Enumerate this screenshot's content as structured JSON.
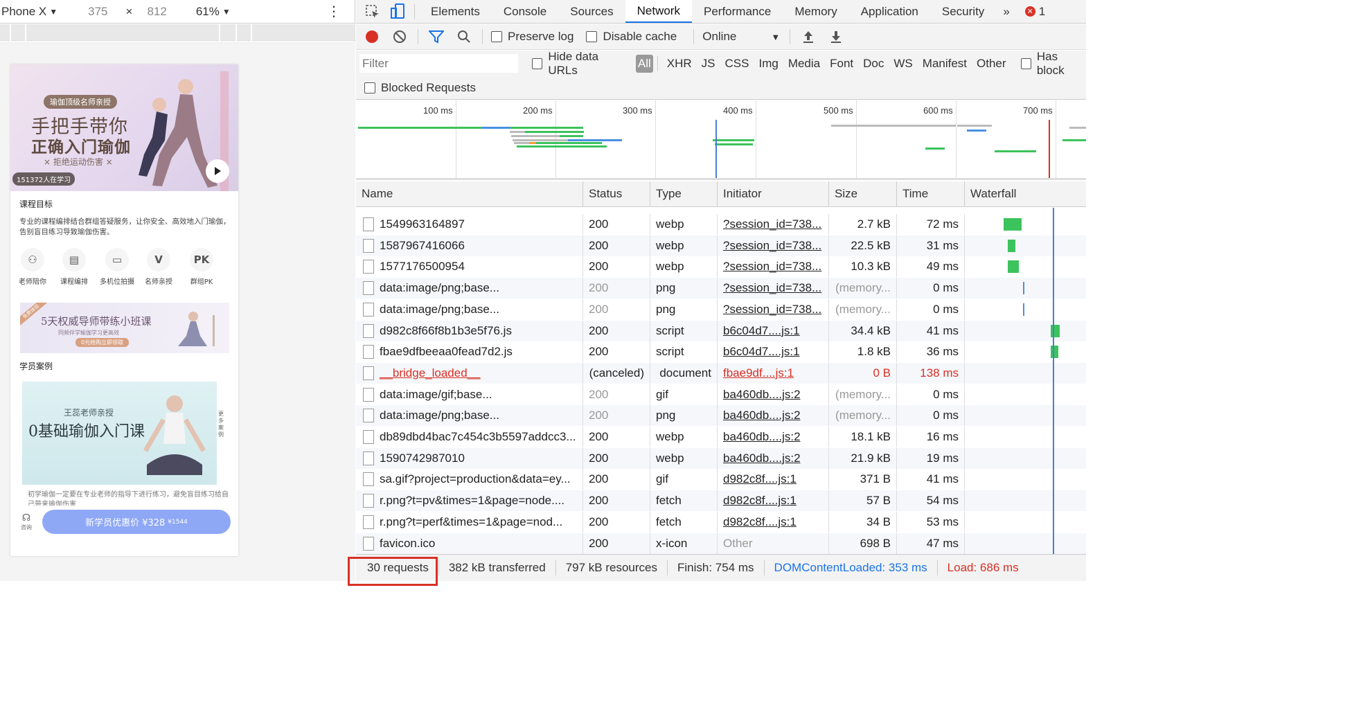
{
  "device_toolbar": {
    "device": "Phone X",
    "width": "375",
    "times": "×",
    "height": "812",
    "zoom": "61%"
  },
  "mobile_page": {
    "hero": {
      "pill": "瑜伽顶级名师亲授",
      "title1": "手把手带你",
      "title2": "正确入门瑜伽",
      "tagline": "× 拒绝运动伤害 ×",
      "learners": "151372人在学习"
    },
    "goal_title": "课程目标",
    "goal_text": "专业的课程编排结合群组答疑服务，让你安全、高效地入门瑜伽，告别盲目练习导致瑜伽伤害。",
    "features": [
      {
        "icon": "people-icon",
        "glyph": "⚇",
        "label": "老师陪你"
      },
      {
        "icon": "book-icon",
        "glyph": "▤",
        "label": "课程编排"
      },
      {
        "icon": "camera-icon",
        "glyph": "▭",
        "label": "多机位拍摄"
      },
      {
        "icon": "v-icon",
        "glyph": "V",
        "label": "名师亲授"
      },
      {
        "icon": "pk-icon",
        "glyph": "PK",
        "label": "群组PK"
      }
    ],
    "banner": {
      "corner": "免费体验",
      "title": "5天权威导师带练小班课",
      "subtitle": "同频伴学瑜伽学习更高效",
      "button": "0元抢购立即领取"
    },
    "cases_title": "学员案例",
    "case": {
      "teacher": "王蕊老师亲授",
      "title": "0基础瑜伽入门课",
      "side": "更多案例"
    },
    "foot_text": "初学瑜伽一定要在专业老师的指导下进行练习，避免盲目练习给自己带来瑜伽伤害",
    "consult": "咨询",
    "cta_label": "新学员优惠价 ¥328",
    "cta_old": "¥1544"
  },
  "devtools": {
    "tabs": [
      "Elements",
      "Console",
      "Sources",
      "Network",
      "Performance",
      "Memory",
      "Application",
      "Security"
    ],
    "active_tab": "Network",
    "more": "»",
    "error_count": "1",
    "toolbar": {
      "preserve_log": "Preserve log",
      "disable_cache": "Disable cache",
      "throttle": "Online"
    },
    "filter_placeholder": "Filter",
    "hide_data_urls": "Hide data URLs",
    "filter_types": [
      "All",
      "XHR",
      "JS",
      "CSS",
      "Img",
      "Media",
      "Font",
      "Doc",
      "WS",
      "Manifest",
      "Other"
    ],
    "has_blocked": "Has block",
    "blocked_requests": "Blocked Requests",
    "overview_ticks": [
      "100 ms",
      "200 ms",
      "300 ms",
      "400 ms",
      "500 ms",
      "600 ms",
      "700 ms"
    ],
    "columns": [
      "Name",
      "Status",
      "Type",
      "Initiator",
      "Size",
      "Time",
      "Waterfall"
    ],
    "rows": [
      {
        "name": "1549963164897",
        "status": "200",
        "type": "webp",
        "initiator": "?session_id=738...",
        "size": "2.7 kB",
        "time": "72 ms"
      },
      {
        "name": "1587967416066",
        "status": "200",
        "type": "webp",
        "initiator": "?session_id=738...",
        "size": "22.5 kB",
        "time": "31 ms"
      },
      {
        "name": "1577176500954",
        "status": "200",
        "type": "webp",
        "initiator": "?session_id=738...",
        "size": "10.3 kB",
        "time": "49 ms"
      },
      {
        "name": "data:image/png;base...",
        "status": "200",
        "type": "png",
        "initiator": "?session_id=738...",
        "size": "(memory...",
        "time": "0 ms"
      },
      {
        "name": "data:image/png;base...",
        "status": "200",
        "type": "png",
        "initiator": "?session_id=738...",
        "size": "(memory...",
        "time": "0 ms"
      },
      {
        "name": "d982c8f66f8b1b3e5f76.js",
        "status": "200",
        "type": "script",
        "initiator": "b6c04d7....js:1",
        "size": "34.4 kB",
        "time": "41 ms"
      },
      {
        "name": "fbae9dfbeeaa0fead7d2.js",
        "status": "200",
        "type": "script",
        "initiator": "b6c04d7....js:1",
        "size": "1.8 kB",
        "time": "36 ms"
      },
      {
        "name": "__bridge_loaded__",
        "status": "(canceled)",
        "type": "document",
        "initiator": "fbae9df....js:1",
        "size": "0 B",
        "time": "138 ms"
      },
      {
        "name": "data:image/gif;base...",
        "status": "200",
        "type": "gif",
        "initiator": "ba460db....js:2",
        "size": "(memory...",
        "time": "0 ms"
      },
      {
        "name": "data:image/png;base...",
        "status": "200",
        "type": "png",
        "initiator": "ba460db....js:2",
        "size": "(memory...",
        "time": "0 ms"
      },
      {
        "name": "db89dbd4bac7c454c3b5597addcc3...",
        "status": "200",
        "type": "webp",
        "initiator": "ba460db....js:2",
        "size": "18.1 kB",
        "time": "16 ms"
      },
      {
        "name": "1590742987010",
        "status": "200",
        "type": "webp",
        "initiator": "ba460db....js:2",
        "size": "21.9 kB",
        "time": "19 ms"
      },
      {
        "name": "sa.gif?project=production&data=ey...",
        "status": "200",
        "type": "gif",
        "initiator": "d982c8f....js:1",
        "size": "371 B",
        "time": "41 ms"
      },
      {
        "name": "r.png?t=pv&times=1&page=node....",
        "status": "200",
        "type": "fetch",
        "initiator": "d982c8f....js:1",
        "size": "57 B",
        "time": "54 ms"
      },
      {
        "name": "r.png?t=perf&times=1&page=nod...",
        "status": "200",
        "type": "fetch",
        "initiator": "d982c8f....js:1",
        "size": "34 B",
        "time": "53 ms"
      },
      {
        "name": "favicon.ico",
        "status": "200",
        "type": "x-icon",
        "initiator": "Other",
        "size": "698 B",
        "time": "47 ms"
      }
    ],
    "status_bar": {
      "requests": "30 requests",
      "transferred": "382 kB transferred",
      "resources": "797 kB resources",
      "finish": "Finish: 754 ms",
      "dcl": "DOMContentLoaded: 353 ms",
      "load": "Load: 686 ms"
    },
    "colors": {
      "accent": "#1a73e8",
      "error": "#d93025",
      "waterfall_green": "#3cc35c",
      "waterfall_blue": "#4a90e2"
    }
  }
}
